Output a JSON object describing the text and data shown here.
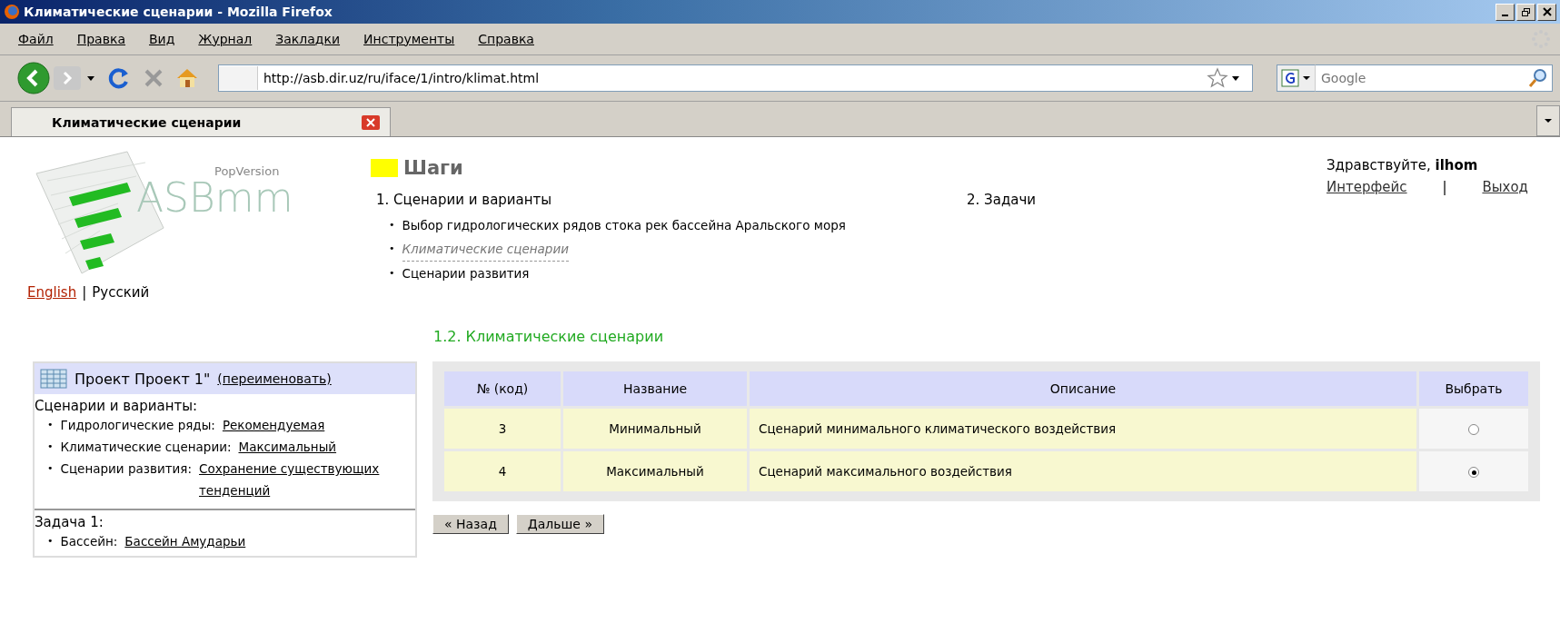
{
  "window": {
    "title": "Климатические сценарии - Mozilla Firefox"
  },
  "menu": [
    "Файл",
    "Правка",
    "Вид",
    "Журнал",
    "Закладки",
    "Инструменты",
    "Справка"
  ],
  "toolbar": {
    "url": "http://asb.dir.uz/ru/iface/1/intro/klimat.html",
    "search_placeholder": "Google"
  },
  "tabs": [
    {
      "label": "Климатические сценарии",
      "selected": true
    }
  ],
  "logo": {
    "subtitle": "PopVersion",
    "name": "ASBmm"
  },
  "steps": {
    "title": "Шаги",
    "bullet": "•",
    "columns": [
      {
        "heading": "1. Сценарии и варианты",
        "items": [
          {
            "label": "Выбор гидрологических рядов стока рек бассейна Аральского моря",
            "current": false
          },
          {
            "label": "Климатические сценарии",
            "current": true
          },
          {
            "label": "Сценарии развития",
            "current": false
          }
        ]
      },
      {
        "heading": "2. Задачи"
      }
    ]
  },
  "user": {
    "greeting": "Здравствуйте, **ilhom**",
    "links": [
      "Интерфейс",
      "Выход"
    ],
    "separator": "|"
  },
  "languages": {
    "items": [
      {
        "label": "English",
        "selected": false
      },
      {
        "label": "Русский",
        "selected": true
      }
    ],
    "separator": "|"
  },
  "section_title": "1.2. Климатические сценарии",
  "project": {
    "title": "Проект Проект 1\"",
    "rename": "(переименовать)",
    "bullet": "•",
    "groups": [
      {
        "heading": "Сценарии и варианты:",
        "items": [
          {
            "label": "Гидрологические ряды:",
            "value": "Рекомендуемая"
          },
          {
            "label": "Климатические сценарии:",
            "value": "Максимальный"
          },
          {
            "label": "Сценарии развития:",
            "value": "Сохранение существующих тенденций"
          }
        ]
      },
      {
        "heading": "Задача 1:",
        "items": [
          {
            "label": "Бассейн:",
            "value": "Бассейн Амударьи"
          }
        ]
      }
    ]
  },
  "table": {
    "columns": [
      "№ (код)",
      "Название",
      "Описание",
      "Выбрать"
    ],
    "rows": [
      {
        "code": "3",
        "name": "Минимальный",
        "description": "Сценарий минимального климатического воздействия",
        "selected": false
      },
      {
        "code": "4",
        "name": "Максимальный",
        "description": "Сценарий максимального воздействия",
        "selected": true
      }
    ]
  },
  "buttons": [
    "« Назад",
    "Дальше »"
  ]
}
